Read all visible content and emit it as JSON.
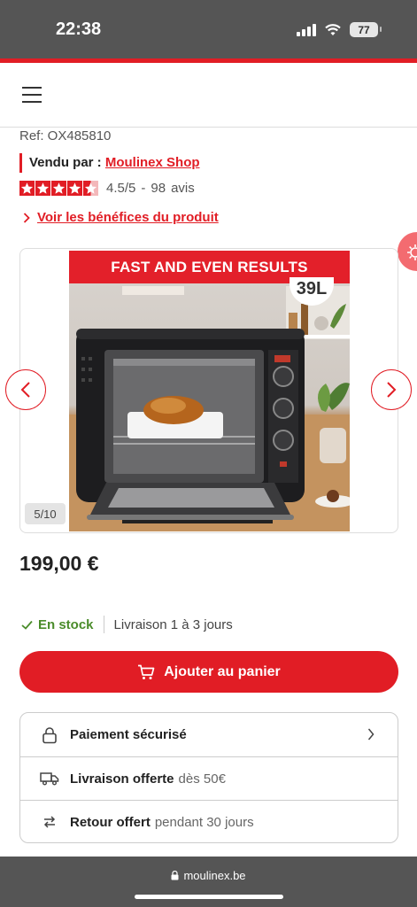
{
  "status_bar": {
    "time": "22:38",
    "battery": "77"
  },
  "product": {
    "ref": "Ref: OX485810",
    "seller_label": "Vendu par :",
    "seller_name": "Moulinex Shop",
    "rating": "4.5/5",
    "rating_value": 4.5,
    "rating_sep": "-",
    "reviews_count": "98",
    "reviews_label": "avis",
    "benefits_link": "Voir les bénéfices du produit",
    "price": "199,00 €"
  },
  "gallery": {
    "banner": "FAST AND EVEN RESULTS",
    "badge": "39L",
    "counter": "5/10"
  },
  "availability": {
    "stock": "En stock",
    "delivery": "Livraison 1 à 3 jours"
  },
  "cart": {
    "label": "Ajouter au panier"
  },
  "info": [
    {
      "icon": "lock-icon",
      "bold": "Paiement sécurisé",
      "rest": ""
    },
    {
      "icon": "truck-icon",
      "bold": "Livraison offerte",
      "rest": "dès 50€"
    },
    {
      "icon": "exchange-icon",
      "bold": "Retour offert",
      "rest": "pendant 30 jours"
    }
  ],
  "browser": {
    "url": "moulinex.be"
  },
  "colors": {
    "accent": "#e11d25",
    "stock_green": "#4a8c2a",
    "chrome": "#555555"
  }
}
